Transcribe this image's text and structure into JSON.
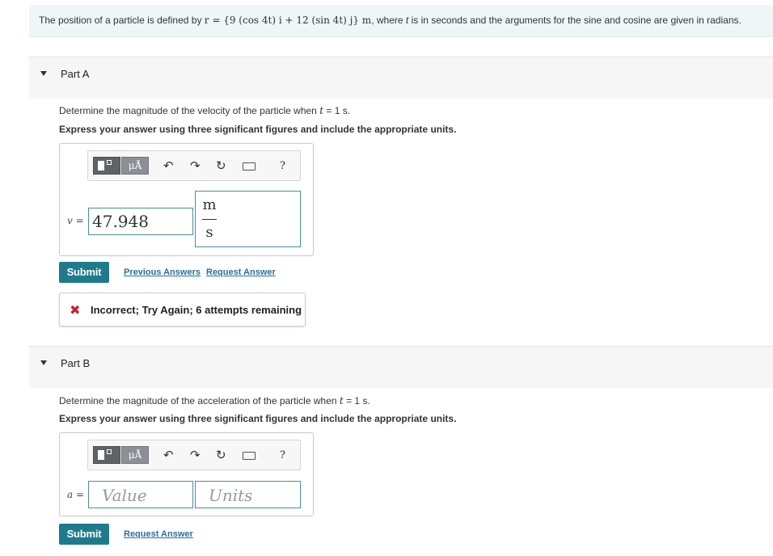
{
  "problem": {
    "prefix": "The position of a particle is defined by",
    "formula": "r = {9 (cos 4t) i + 12 (sin 4t) j} m",
    "suffix_a": ", where",
    "var_t": "t",
    "suffix_b": "is in seconds and the arguments for the sine and cosine are given in radians."
  },
  "toolbar": {
    "mu_label": "μÅ",
    "help_label": "?"
  },
  "partA": {
    "title": "Part A",
    "question_prefix": "Determine the magnitude of the velocity of the particle when",
    "question_var": "t",
    "question_suffix": "= 1 s.",
    "instruction": "Express your answer using three significant figures and include the appropriate units.",
    "var_label": "v =",
    "value": "47.948",
    "unit_numerator": "m",
    "unit_denominator": "s",
    "submit": "Submit",
    "previous_answers": "Previous Answers",
    "request_answer": "Request Answer",
    "feedback": "Incorrect; Try Again; 6 attempts remaining"
  },
  "partB": {
    "title": "Part B",
    "question_prefix": "Determine the magnitude of the acceleration of the particle when",
    "question_var": "t",
    "question_suffix": "= 1 s.",
    "instruction": "Express your answer using three significant figures and include the appropriate units.",
    "var_label": "a =",
    "value_placeholder": "Value",
    "units_placeholder": "Units",
    "submit": "Submit",
    "request_answer": "Request Answer"
  },
  "colors": {
    "submit_bg": "#1f7a8c",
    "link": "#2a6f9b",
    "error": "#c8202f",
    "problem_bg": "#eef6f8"
  }
}
